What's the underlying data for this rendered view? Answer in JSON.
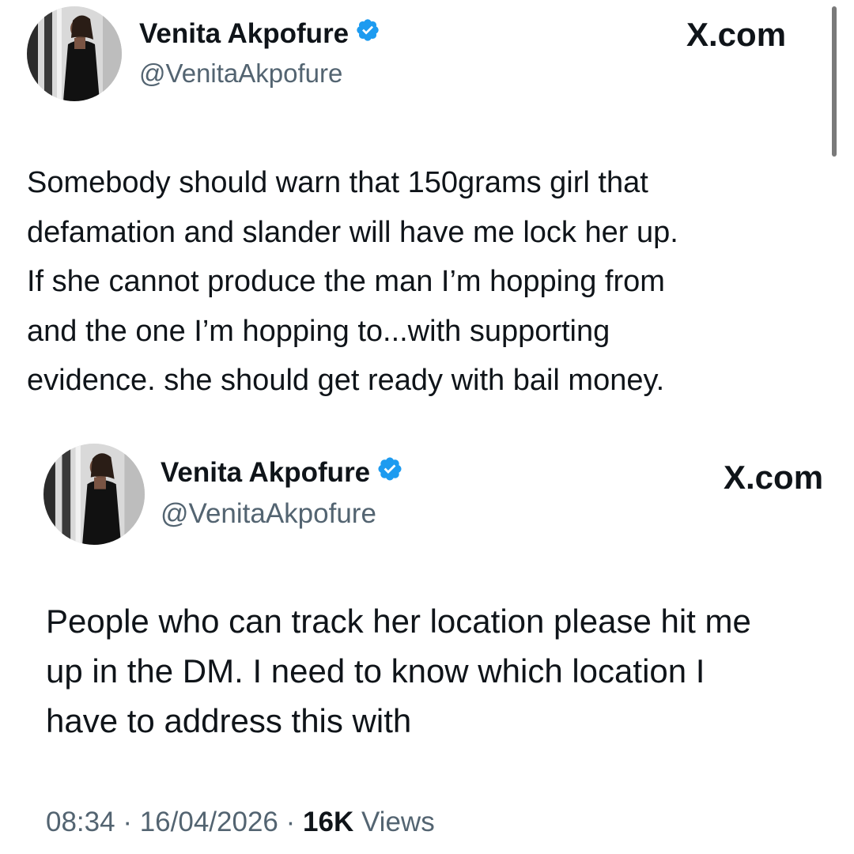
{
  "colors": {
    "text": "#0f1419",
    "secondary": "#536471",
    "verified_badge": "#1d9bf0",
    "background": "#ffffff"
  },
  "tweets": [
    {
      "author": {
        "display_name": "Venita Akpofure",
        "handle": "@VenitaAkpofure",
        "verified_icon": "verified-badge-icon",
        "avatar_icon": "profile-photo"
      },
      "brand": "X.com",
      "text_lines": [
        "Somebody should warn that 150grams girl that",
        "defamation and slander will have me lock her up.",
        "If she cannot produce the man I’m hopping from",
        "and the one I’m hopping to...with supporting",
        "evidence. she should get ready with bail money."
      ]
    },
    {
      "author": {
        "display_name": "Venita Akpofure",
        "handle": "@VenitaAkpofure",
        "verified_icon": "verified-badge-icon",
        "avatar_icon": "profile-photo"
      },
      "brand": "X.com",
      "text_lines": [
        "People who can track her location please hit me",
        "up in the DM. I need to know which location I",
        "have to address this with"
      ],
      "meta": {
        "time": "08:34",
        "separator": "·",
        "date": "16/04/2026",
        "views_count": "16K",
        "views_label": "Views"
      }
    }
  ]
}
